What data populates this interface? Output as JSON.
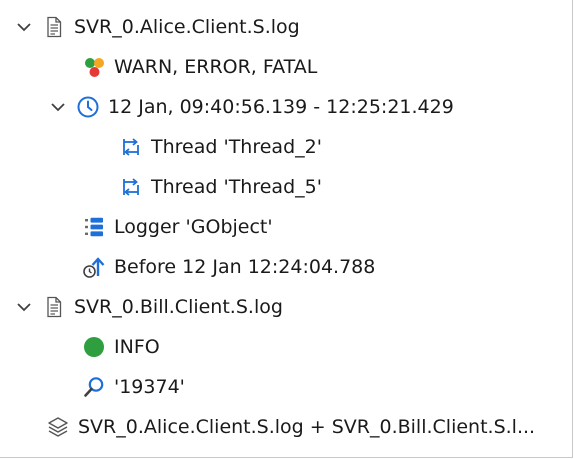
{
  "tree": {
    "file1": {
      "label": "SVR_0.Alice.Client.S.log",
      "icon": "document-icon",
      "expanded": true,
      "children": {
        "levels": {
          "label": "WARN, ERROR, FATAL",
          "icon": "log-levels-icon",
          "colors": [
            "#2e9e3e",
            "#f5a623",
            "#e53935"
          ]
        },
        "time": {
          "label": "12 Jan, 09:40:56.139 - 12:25:21.429",
          "icon": "clock-icon",
          "expanded": true,
          "children": {
            "thread2": {
              "label": "Thread 'Thread_2'",
              "icon": "thread-icon"
            },
            "thread5": {
              "label": "Thread 'Thread_5'",
              "icon": "thread-icon"
            }
          }
        },
        "logger": {
          "label": "Logger 'GObject'",
          "icon": "logger-icon"
        },
        "before": {
          "label": "Before 12 Jan 12:24:04.788",
          "icon": "time-before-icon"
        }
      }
    },
    "file2": {
      "label": "SVR_0.Bill.Client.S.log",
      "icon": "document-icon",
      "expanded": true,
      "children": {
        "info": {
          "label": "INFO",
          "icon": "info-level-icon",
          "color": "#2e9e3e"
        },
        "search": {
          "label": "'19374'",
          "icon": "search-icon"
        }
      }
    },
    "merged": {
      "label": "SVR_0.Alice.Client.S.log + SVR_0.Bill.Client.S.l...",
      "icon": "layers-icon"
    }
  },
  "colors": {
    "accent": "#1e6fd9",
    "chevron": "#404040",
    "icon_gray": "#6a6a6a"
  }
}
